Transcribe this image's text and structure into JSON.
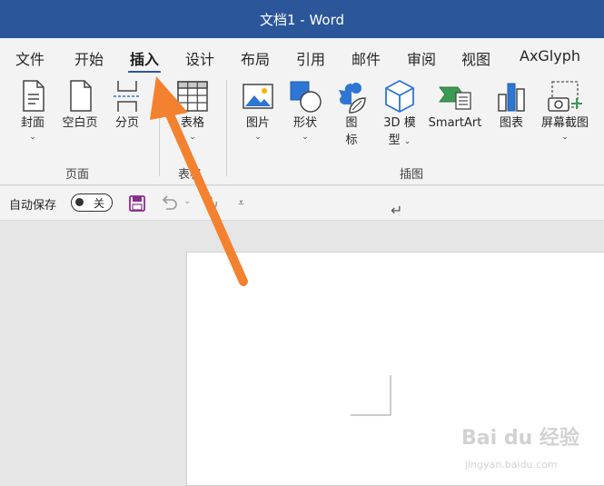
{
  "titlebar": {
    "title": "文档1  -  Word"
  },
  "tabs": [
    {
      "label": "文件"
    },
    {
      "label": "开始"
    },
    {
      "label": "插入"
    },
    {
      "label": "设计"
    },
    {
      "label": "布局"
    },
    {
      "label": "引用"
    },
    {
      "label": "邮件"
    },
    {
      "label": "审阅"
    },
    {
      "label": "视图"
    },
    {
      "label": "AxGlyph"
    }
  ],
  "active_tab": "插入",
  "ribbon": {
    "pages_group": {
      "label": "页面",
      "buttons": [
        {
          "label": "封面",
          "dropdown": "⌄",
          "icon": "cover-page-icon"
        },
        {
          "label": "空白页",
          "icon": "blank-page-icon"
        },
        {
          "label": "分页",
          "icon": "page-break-icon"
        }
      ]
    },
    "table_group": {
      "label": "表格",
      "buttons": [
        {
          "label": "表格",
          "dropdown": "⌄",
          "icon": "table-icon"
        }
      ]
    },
    "illustrations_group": {
      "label": "插图",
      "buttons": [
        {
          "label": "图片",
          "dropdown": "⌄",
          "icon": "picture-icon"
        },
        {
          "label": "形状",
          "dropdown": "⌄",
          "icon": "shapes-icon"
        },
        {
          "label_line1": "图",
          "label_line2": "标",
          "icon": "icons-icon"
        },
        {
          "label_line1": "3D 模",
          "label_line2": "型",
          "dropdown": "⌄",
          "icon": "3d-model-icon"
        },
        {
          "label": "SmartArt",
          "icon": "smartart-icon"
        },
        {
          "label": "图表",
          "icon": "chart-icon"
        },
        {
          "label": "屏幕截图",
          "dropdown": "⌄",
          "icon": "screenshot-icon"
        }
      ]
    }
  },
  "qat": {
    "autosave_label": "自动保存",
    "autosave_state": "关",
    "save_icon": "save-icon",
    "undo_icon": "undo-icon",
    "redo_icon": "redo-icon",
    "customize_icon": "customize-qat-icon",
    "undo_dropdown": "⌄",
    "customize_glyph": "⩡"
  },
  "document": {
    "paragraph_mark": "↵"
  },
  "watermark": {
    "text": "Bai du 经验",
    "sub": "jingyan.baidu.com"
  },
  "colors": {
    "title_bar": "#2b579a",
    "ribbon_bg": "#f3f3f3",
    "canvas_bg": "#e6e6e6",
    "arrow": "#f4812f"
  }
}
